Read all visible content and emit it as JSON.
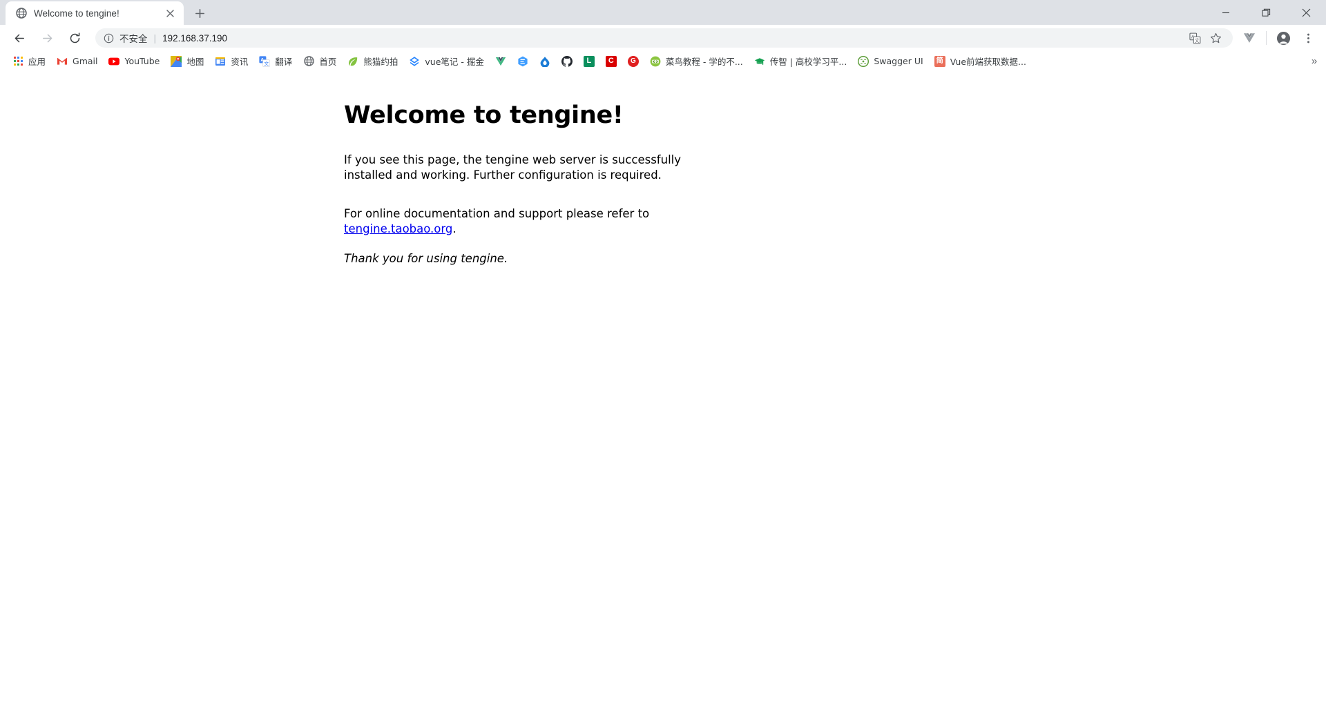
{
  "window": {
    "controls": [
      {
        "name": "minimize",
        "glyph": "minimize-icon"
      },
      {
        "name": "maximize",
        "glyph": "restore-icon"
      },
      {
        "name": "close",
        "glyph": "close-icon"
      }
    ]
  },
  "tabstrip": {
    "tab": {
      "title": "Welcome to tengine!",
      "favicon": "globe-icon",
      "close_label": "✕"
    },
    "new_tab_label": "+"
  },
  "toolbar": {
    "back_label": "←",
    "forward_label": "→",
    "reload_label": "↻",
    "omnibox": {
      "info_icon": "info-circle-icon",
      "security_text": "不安全",
      "separator": "|",
      "url": "192.168.37.190"
    },
    "translate_icon": "translate-icon",
    "bookmark_star_icon": "star-icon",
    "extension_vue_icon": "vue-devtools-icon",
    "profile_icon": "profile-avatar-icon",
    "menu_icon": "three-dot-menu-icon"
  },
  "bookmarks": {
    "overflow_label": "»",
    "items": [
      {
        "label": "应用",
        "icon": "apps-grid-icon"
      },
      {
        "label": "Gmail",
        "icon": "gmail-icon"
      },
      {
        "label": "YouTube",
        "icon": "youtube-icon"
      },
      {
        "label": "地图",
        "icon": "google-maps-icon"
      },
      {
        "label": "资讯",
        "icon": "google-news-icon"
      },
      {
        "label": "翻译",
        "icon": "google-translate-icon"
      },
      {
        "label": "首页",
        "icon": "globe-icon"
      },
      {
        "label": "熊猫约拍",
        "icon": "leaf-icon"
      },
      {
        "label": "vue笔记 - 掘金",
        "icon": "juejin-icon"
      },
      {
        "label": "",
        "icon": "vue-icon"
      },
      {
        "label": "",
        "icon": "element-ui-icon"
      },
      {
        "label": "",
        "icon": "droplet-icon"
      },
      {
        "label": "",
        "icon": "github-icon"
      },
      {
        "label": "",
        "icon": "leetcode-l-icon"
      },
      {
        "label": "",
        "icon": "c-red-icon"
      },
      {
        "label": "",
        "icon": "g-red-icon"
      },
      {
        "label": "菜鸟教程 - 学的不...",
        "icon": "runoob-icon"
      },
      {
        "label": "传智 | 高校学习平...",
        "icon": "graduation-cap-icon"
      },
      {
        "label": "Swagger UI",
        "icon": "swagger-icon"
      },
      {
        "label": "Vue前端获取数据...",
        "icon": "jianshu-icon"
      }
    ]
  },
  "page": {
    "heading": "Welcome to tengine!",
    "paragraph1": "If you see this page, the tengine web server is successfully installed and working. Further configuration is required.",
    "paragraph2_prefix": "For online documentation and support please refer to ",
    "link_text": "tengine.taobao.org",
    "paragraph2_suffix": ".",
    "thanks": "Thank you for using tengine."
  },
  "colors": {
    "chrome_tabstrip": "#dee1e6",
    "omnibox_bg": "#f1f3f4",
    "link": "#0000ee",
    "text": "#202124"
  }
}
